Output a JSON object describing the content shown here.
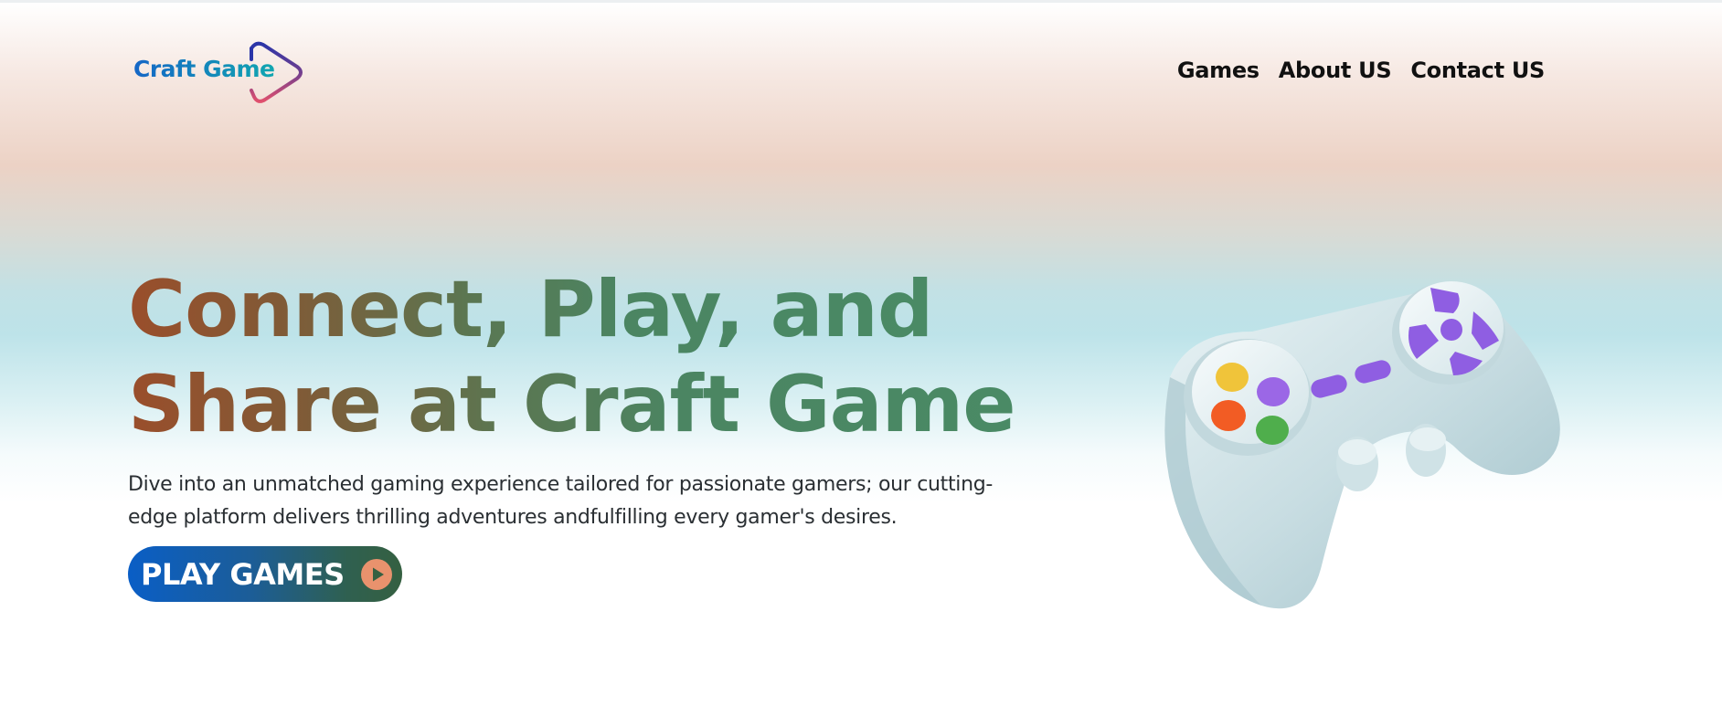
{
  "header": {
    "logo_text": "Craft Game",
    "nav": [
      {
        "label": "Games"
      },
      {
        "label": "About US"
      },
      {
        "label": "Contact US"
      }
    ]
  },
  "hero": {
    "headline_line1": "Connect, Play, and",
    "headline_line2": "Share at Craft Game",
    "description": "Dive into an unmatched gaming experience tailored for passionate gamers; our cutting-edge platform delivers thrilling adventures andfulfilling every gamer's desires.",
    "cta_label": "PLAY GAMES",
    "cta_icon": "play-circle-icon",
    "illustration": "game-controller-icon"
  },
  "colors": {
    "headline_start": "#9a4e2b",
    "headline_end": "#4a8a65",
    "cta_start": "#0a5ec6",
    "cta_end": "#356041",
    "play_icon": "#e9926d",
    "logo_blue": "#1566c6",
    "logo_teal": "#12a6b0"
  }
}
